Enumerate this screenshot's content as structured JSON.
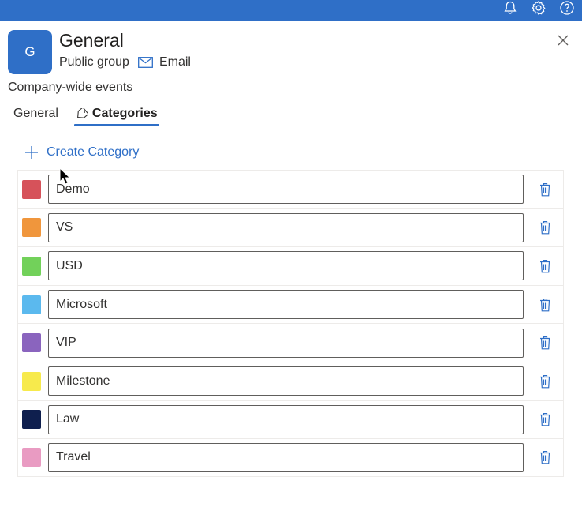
{
  "group": {
    "avatar_initial": "G",
    "title": "General",
    "privacy": "Public group",
    "email_label": "Email",
    "description": "Company-wide events"
  },
  "tabs": [
    {
      "label": "General",
      "active": false
    },
    {
      "label": "Categories",
      "active": true,
      "icon": "tag-icon"
    }
  ],
  "create_category_label": "Create Category",
  "categories": [
    {
      "name": "Demo",
      "color": "#d6525a"
    },
    {
      "name": "VS",
      "color": "#f0963c"
    },
    {
      "name": "USD",
      "color": "#72d15a"
    },
    {
      "name": "Microsoft",
      "color": "#5bb9ee"
    },
    {
      "name": "VIP",
      "color": "#8a64be"
    },
    {
      "name": "Milestone",
      "color": "#f7ea4c"
    },
    {
      "name": "Law",
      "color": "#0f1f4e"
    },
    {
      "name": "Travel",
      "color": "#e99bc2"
    }
  ],
  "colors": {
    "accent": "#2f6fc7",
    "topbar": "#2f6fc7"
  },
  "icons": {
    "topbar": [
      "bell-icon",
      "gear-icon",
      "help-icon"
    ],
    "close": "close-icon",
    "email": "mail-icon",
    "create": "plus-icon",
    "delete": "trash-icon"
  }
}
